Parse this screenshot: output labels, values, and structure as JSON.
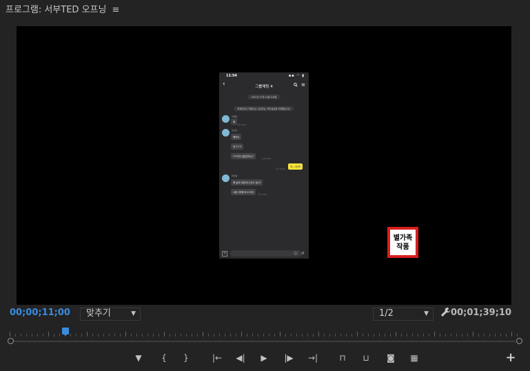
{
  "panel": {
    "title": "프로그램: 서부TED 오프닝",
    "menu_glyph": "≡"
  },
  "video": {
    "phone": {
      "time": "11:54",
      "status_icons": "▪▪ ◠ ▮",
      "back": "‹",
      "chat_title": "그룹채팅 4",
      "search_glyph": "🔍",
      "menu_glyph": "≡",
      "date_pill": "2021년 11월 10일 수요일",
      "system_pill": "최재진님이 이혜진님, 김수민님, 박진섭님을 초대했습니다.",
      "messages": [
        {
          "sender": "이혜진",
          "text": "헤",
          "time": "오후 11:51"
        },
        {
          "sender": "김수민",
          "text": "혜진씨",
          "time": ""
        },
        {
          "sender": "",
          "text": "앗ㅋㅋㅋ",
          "time": ""
        },
        {
          "sender": "",
          "text": "***이의 대답만하나?",
          "time": "오후 11:52"
        },
        {
          "sender": "",
          "text": "어....어어?",
          "time": "오후 11:52",
          "mine": true
        },
        {
          "sender": "박진섭",
          "text": "혜 높여 대답하나 듣고 싶나?",
          "time": ""
        },
        {
          "sender": "",
          "text": "너랑 3번째 토고 어이",
          "time": "오후 11:53"
        }
      ],
      "input_plus": "+",
      "input_emoji": "☺",
      "input_hash": "#"
    },
    "badge": {
      "line1": "별가족",
      "line2": "작품"
    }
  },
  "controls": {
    "timecode_current": "00;00;11;00",
    "zoom_select": "맞추기",
    "resolution_select": "1/2",
    "settings_icon": "🔧",
    "timecode_duration": "00;01;39;10",
    "playhead_fraction": 0.11
  },
  "transport": [
    {
      "name": "add-marker-button",
      "glyph": "▼"
    },
    {
      "name": "mark-in-button",
      "glyph": "{"
    },
    {
      "name": "mark-out-button",
      "glyph": "}"
    },
    {
      "name": "go-to-in-button",
      "glyph": "|←"
    },
    {
      "name": "step-back-button",
      "glyph": "◀|"
    },
    {
      "name": "play-button",
      "glyph": "▶"
    },
    {
      "name": "step-forward-button",
      "glyph": "|▶"
    },
    {
      "name": "go-to-out-button",
      "glyph": "→|"
    },
    {
      "name": "lift-button",
      "glyph": "⊓"
    },
    {
      "name": "extract-button",
      "glyph": "⊔"
    },
    {
      "name": "export-frame-button",
      "glyph": "◙"
    },
    {
      "name": "comparison-view-button",
      "glyph": "▦"
    },
    {
      "name": "button-editor-button",
      "glyph": "+"
    }
  ]
}
